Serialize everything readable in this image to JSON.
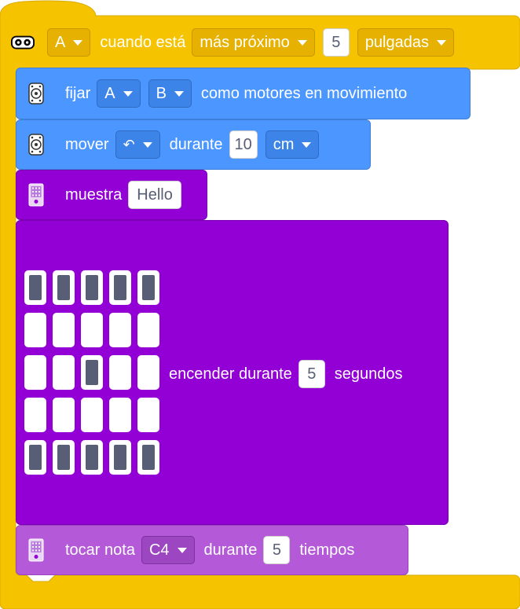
{
  "colors": {
    "events_yellow": "#f6c300",
    "motion_blue": "#4c97ff",
    "display_purple": "#9300d6",
    "sound_violet": "#b45ad8"
  },
  "hat": {
    "icon": "distance-sensor-icon",
    "port": "A",
    "label_when": "cuando está",
    "condition": "más próximo",
    "distance": "5",
    "unit": "pulgadas"
  },
  "set_motors": {
    "icon": "motor-icon",
    "label": "fijar",
    "port1": "A",
    "port2": "B",
    "suffix": "como motores en movimiento"
  },
  "move": {
    "icon": "motor-icon",
    "label": "mover",
    "direction_icon": "rotate-counterclockwise-icon",
    "direction_symbol": "↶",
    "for_label": "durante",
    "amount": "10",
    "unit": "cm"
  },
  "show": {
    "icon": "hub-display-icon",
    "label": "muestra",
    "text": "Hello"
  },
  "light_matrix": {
    "pixels": [
      [
        1,
        1,
        1,
        1,
        1
      ],
      [
        0,
        0,
        0,
        0,
        0
      ],
      [
        0,
        0,
        1,
        0,
        0
      ],
      [
        0,
        0,
        0,
        0,
        0
      ],
      [
        1,
        1,
        1,
        1,
        1
      ]
    ],
    "label": "encender durante",
    "seconds": "5",
    "unit": "segundos"
  },
  "play_note": {
    "icon": "hub-display-icon",
    "label": "tocar nota",
    "note": "C4",
    "for_label": "durante",
    "beats": "5",
    "unit": "tiempos"
  }
}
